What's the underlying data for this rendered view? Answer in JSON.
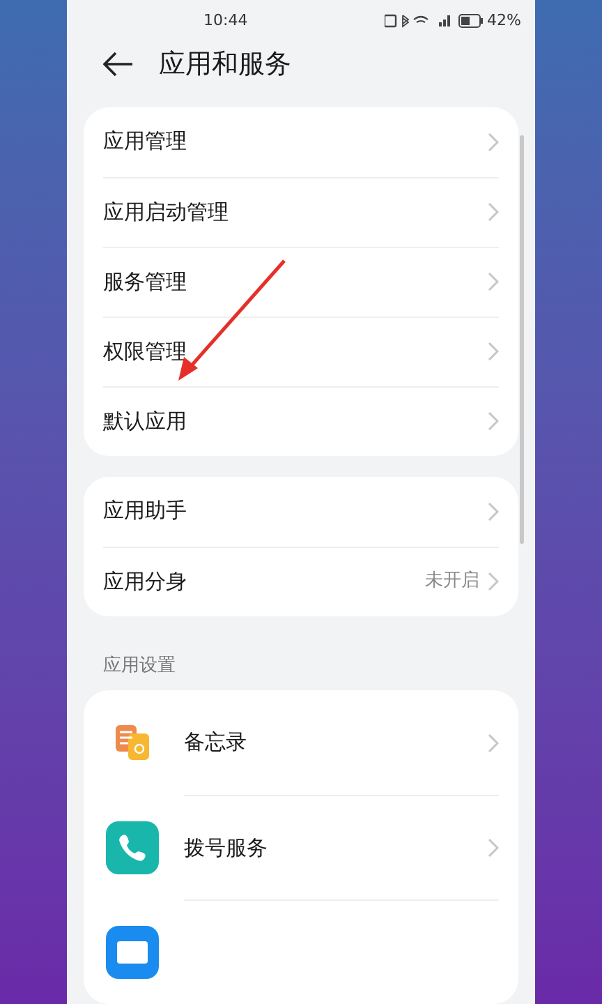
{
  "status_bar": {
    "time": "10:44",
    "battery": "42%"
  },
  "header": {
    "title": "应用和服务"
  },
  "groups": [
    {
      "items": [
        {
          "label": "应用管理"
        },
        {
          "label": "应用启动管理"
        },
        {
          "label": "服务管理"
        },
        {
          "label": "权限管理"
        },
        {
          "label": "默认应用"
        }
      ]
    },
    {
      "items": [
        {
          "label": "应用助手"
        },
        {
          "label": "应用分身",
          "value": "未开启"
        }
      ]
    }
  ],
  "section": {
    "title": "应用设置",
    "items": [
      {
        "label": "备忘录",
        "kind": "notes"
      },
      {
        "label": "拨号服务",
        "kind": "phone"
      },
      {
        "kind": "mail"
      }
    ]
  }
}
